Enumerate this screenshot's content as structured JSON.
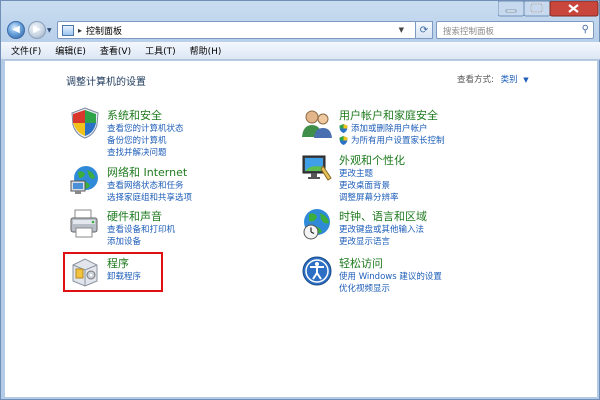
{
  "window": {
    "breadcrumb": "控制面板",
    "address_separator": "▸",
    "search_placeholder": "搜索控制面板"
  },
  "menu": [
    "文件(F)",
    "编辑(E)",
    "查看(V)",
    "工具(T)",
    "帮助(H)"
  ],
  "main": {
    "heading": "调整计算机的设置",
    "view_by_label": "查看方式:",
    "view_by_value": "类别"
  },
  "categories": {
    "security": {
      "title": "系统和安全",
      "links": [
        "查看您的计算机状态",
        "备份您的计算机",
        "查找并解决问题"
      ]
    },
    "network": {
      "title": "网络和 Internet",
      "links": [
        "查看网络状态和任务",
        "选择家庭组和共享选项"
      ]
    },
    "hardware": {
      "title": "硬件和声音",
      "links": [
        "查看设备和打印机",
        "添加设备"
      ]
    },
    "programs": {
      "title": "程序",
      "links": [
        "卸载程序"
      ]
    },
    "accounts": {
      "title": "用户帐户和家庭安全",
      "links": [
        "添加或删除用户帐户",
        "为所有用户设置家长控制"
      ]
    },
    "appearance": {
      "title": "外观和个性化",
      "links": [
        "更改主题",
        "更改桌面背景",
        "调整屏幕分辨率"
      ]
    },
    "clock": {
      "title": "时钟、语言和区域",
      "links": [
        "更改键盘或其他输入法",
        "更改显示语言"
      ]
    },
    "access": {
      "title": "轻松访问",
      "links": [
        "使用 Windows 建议的设置",
        "优化视频显示"
      ]
    }
  },
  "colors": {
    "category_title": "#1e7a1e",
    "link": "#1e5eb8",
    "highlight_box": "#e01010"
  }
}
